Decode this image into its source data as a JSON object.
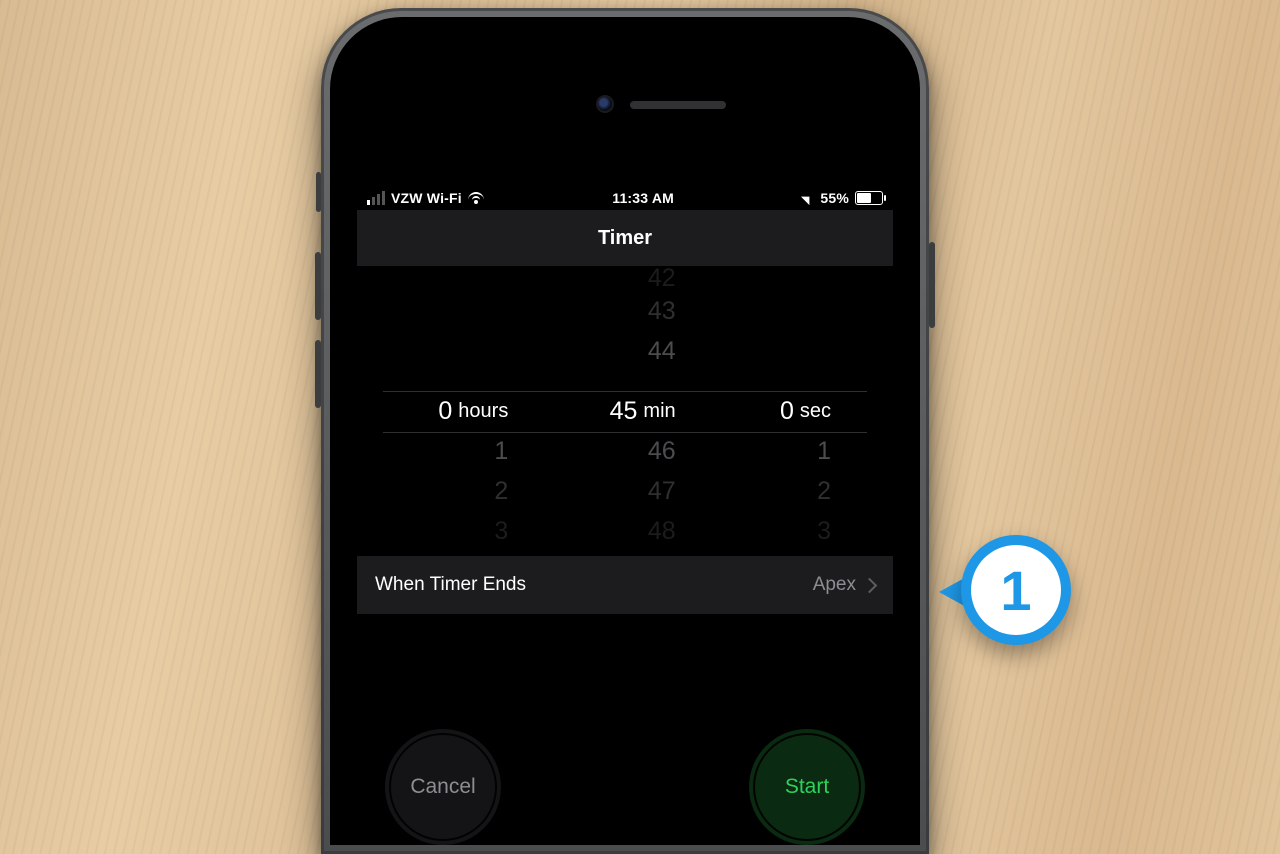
{
  "status": {
    "carrier": "VZW Wi-Fi",
    "time": "11:33 AM",
    "battery_pct": "55%"
  },
  "title": "Timer",
  "picker": {
    "hours": {
      "selected": "0",
      "unit": "hours",
      "below": [
        "1",
        "2",
        "3"
      ]
    },
    "mins": {
      "selected": "45",
      "unit": "min",
      "above": [
        "42",
        "43",
        "44"
      ],
      "below": [
        "46",
        "47",
        "48"
      ]
    },
    "secs": {
      "selected": "0",
      "unit": "sec",
      "below": [
        "1",
        "2",
        "3"
      ]
    }
  },
  "when_ends": {
    "label": "When Timer Ends",
    "value": "Apex"
  },
  "buttons": {
    "cancel": "Cancel",
    "start": "Start"
  },
  "annotation": {
    "number": "1"
  }
}
